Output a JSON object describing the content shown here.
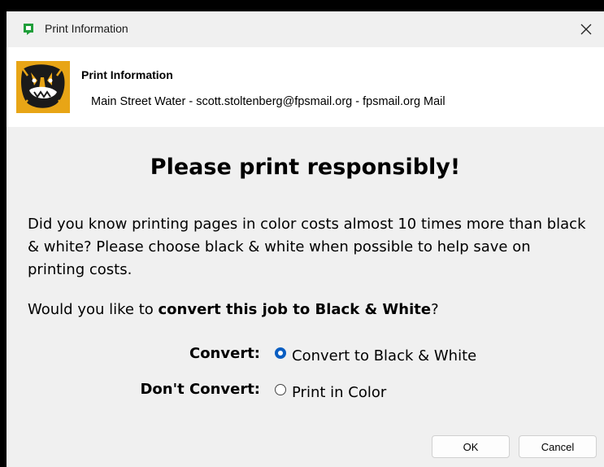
{
  "window": {
    "title": "Print Information"
  },
  "header": {
    "title": "Print Information",
    "subtitle": "Main Street Water - scott.stoltenberg@fpsmail.org - fpsmail.org Mail"
  },
  "main": {
    "headline": "Please print responsibly!",
    "body": "Did you know printing pages in color costs almost 10 times more than black & white? Please choose black & white when possible to help save on printing costs.",
    "question_prefix": "Would you like to ",
    "question_bold": "convert this job to Black & White",
    "question_suffix": "?",
    "options": [
      {
        "label": "Convert:",
        "text": "Convert to Black & White",
        "selected": true
      },
      {
        "label": "Don't Convert:",
        "text": "Print in Color",
        "selected": false
      }
    ]
  },
  "buttons": {
    "ok": "OK",
    "cancel": "Cancel"
  },
  "colors": {
    "accent": "#0a5ec2",
    "app_icon": "#1f9e3a",
    "logo_gold": "#e8a516"
  },
  "icons": {
    "app": "green-document-icon",
    "close": "close-icon",
    "logo": "tiger-logo-icon"
  }
}
